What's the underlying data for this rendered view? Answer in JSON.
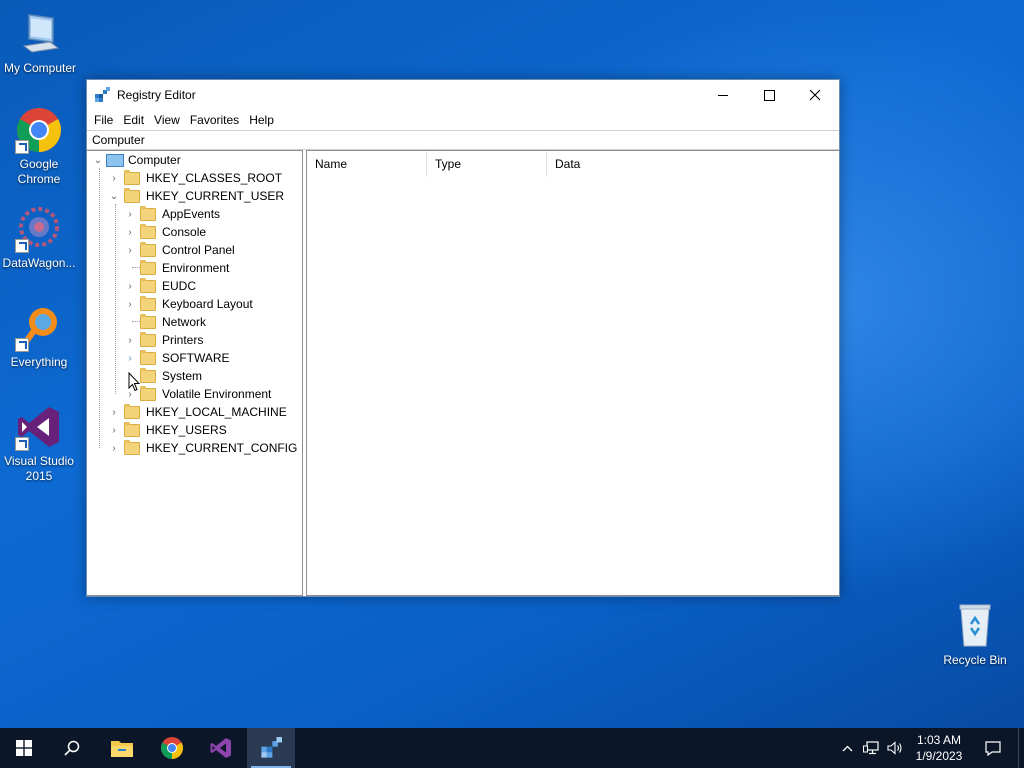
{
  "desktop": {
    "icons": [
      {
        "label": "My Computer"
      },
      {
        "label": "Google Chrome"
      },
      {
        "label": "DataWagon..."
      },
      {
        "label": "Everything"
      },
      {
        "label": "Visual Studio 2015"
      },
      {
        "label": "Recycle Bin"
      }
    ]
  },
  "window": {
    "title": "Registry Editor",
    "menu": [
      "File",
      "Edit",
      "View",
      "Favorites",
      "Help"
    ],
    "address": "Computer",
    "tree": {
      "root": "Computer",
      "hives": [
        "HKEY_CLASSES_ROOT",
        "HKEY_CURRENT_USER",
        "HKEY_LOCAL_MACHINE",
        "HKEY_USERS",
        "HKEY_CURRENT_CONFIG"
      ],
      "current_user_children": [
        "AppEvents",
        "Console",
        "Control Panel",
        "Environment",
        "EUDC",
        "Keyboard Layout",
        "Network",
        "Printers",
        "SOFTWARE",
        "System",
        "Volatile Environment"
      ]
    },
    "columns": [
      "Name",
      "Type",
      "Data"
    ]
  },
  "taskbar": {
    "time": "1:03 AM",
    "date": "1/9/2023"
  },
  "colors": {
    "desktop_blue": "#0d6ad2",
    "taskbar": "#0b1628",
    "folder": "#f3d47a"
  }
}
